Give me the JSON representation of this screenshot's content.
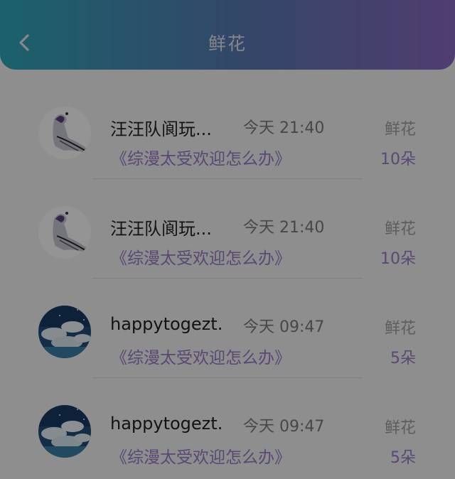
{
  "header": {
    "title": "鲜花",
    "back_icon": "chevron-left-icon"
  },
  "items": [
    {
      "avatar": "ghost-figure-avatar",
      "name": "汪汪队阆玩...",
      "time": "今天 21:40",
      "type_label": "鲜花",
      "work": "《综漫太受欢迎怎么办》",
      "count": "10朵"
    },
    {
      "avatar": "ghost-figure-avatar",
      "name": "汪汪队阆玩...",
      "time": "今天 21:40",
      "type_label": "鲜花",
      "work": "《综漫太受欢迎怎么办》",
      "count": "10朵"
    },
    {
      "avatar": "sky-clouds-avatar",
      "name": "happytogezt...",
      "time": "今天 09:47",
      "type_label": "鲜花",
      "work": "《综漫太受欢迎怎么办》",
      "count": "5朵"
    },
    {
      "avatar": "sky-clouds-avatar",
      "name": "happytogezt...",
      "time": "今天 09:47",
      "type_label": "鲜花",
      "work": "《综漫太受欢迎怎么办》",
      "count": "5朵"
    }
  ],
  "colors": {
    "header_gradient_start": "#2fa8b8",
    "header_gradient_end": "#8a6ac0",
    "accent_purple": "#9a7bc8"
  }
}
